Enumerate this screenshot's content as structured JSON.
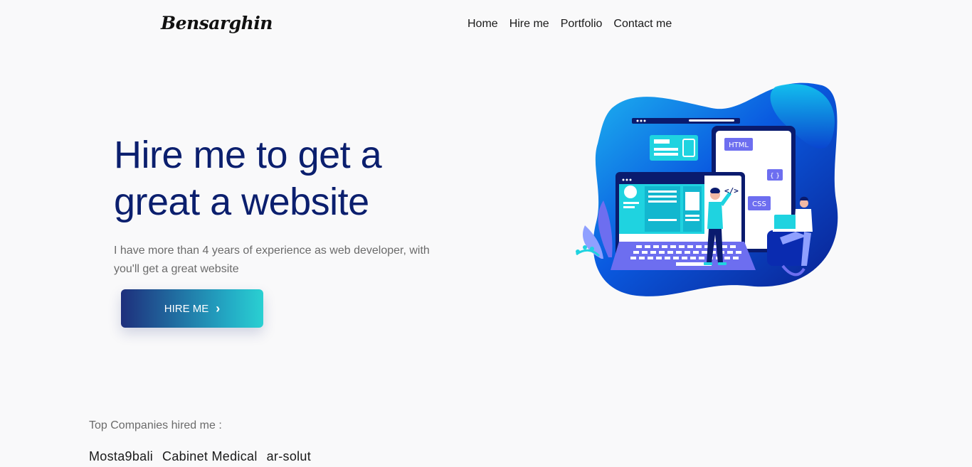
{
  "brand": {
    "name": "Bensarghin"
  },
  "nav": {
    "items": [
      "Home",
      "Hire me",
      "Portfolio",
      "Contact me"
    ]
  },
  "hero": {
    "title_line1": "Hire me to get a",
    "title_line2": "great a website",
    "subtitle": "I have more than 4 years of experience as web developer, with you'll get a great website",
    "cta_label": "HIRE ME",
    "cta_icon": "chevron-right-icon"
  },
  "illustration": {
    "labels": {
      "html": "HTML",
      "css": "CSS",
      "braces": "{ }",
      "code": "</>"
    }
  },
  "companies": {
    "label": "Top Companies hired me :",
    "items": [
      "Mosta9bali",
      "Cabinet Medical",
      "ar-solut"
    ]
  },
  "colors": {
    "primary": "#0b1f6e",
    "button_start": "#1e2f7c",
    "button_end": "#2ad0d2",
    "blob_blue": "#0a3fd6",
    "cyan": "#1fd3e0"
  }
}
